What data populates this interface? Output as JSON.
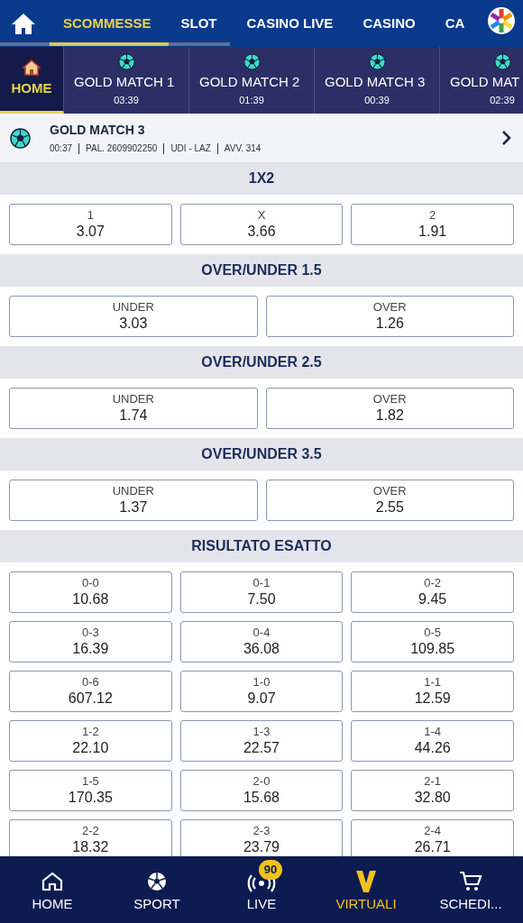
{
  "top_nav": {
    "items": [
      {
        "label": "SCOMMESSE",
        "selected": true
      },
      {
        "label": "SLOT",
        "selected": false
      },
      {
        "label": "CASINO LIVE",
        "selected": false
      },
      {
        "label": "CASINO",
        "selected": false
      },
      {
        "label": "CA",
        "selected": false
      }
    ]
  },
  "match_tabs": [
    {
      "kind": "home",
      "label": "HOME",
      "selected": true
    },
    {
      "kind": "match",
      "label": "GOLD MATCH 1",
      "time": "03:39",
      "selected": false
    },
    {
      "kind": "match",
      "label": "GOLD MATCH 2",
      "time": "01:39",
      "selected": false
    },
    {
      "kind": "match",
      "label": "GOLD MATCH 3",
      "time": "00:39",
      "selected": false
    },
    {
      "kind": "match",
      "label": "GOLD MAT",
      "time": "02:39",
      "selected": false
    }
  ],
  "event": {
    "title": "GOLD MATCH 3",
    "info": [
      "00:37",
      "PAL. 2609902250",
      "UDI - LAZ",
      "AVV. 314"
    ]
  },
  "markets": [
    {
      "title": "1X2",
      "outcomes": [
        {
          "label": "1",
          "odd": "3.07"
        },
        {
          "label": "X",
          "odd": "3.66"
        },
        {
          "label": "2",
          "odd": "1.91"
        }
      ]
    },
    {
      "title": "OVER/UNDER 1.5",
      "outcomes": [
        {
          "label": "UNDER",
          "odd": "3.03"
        },
        {
          "label": "OVER",
          "odd": "1.26"
        }
      ]
    },
    {
      "title": "OVER/UNDER 2.5",
      "outcomes": [
        {
          "label": "UNDER",
          "odd": "1.74"
        },
        {
          "label": "OVER",
          "odd": "1.82"
        }
      ]
    },
    {
      "title": "OVER/UNDER 3.5",
      "outcomes": [
        {
          "label": "UNDER",
          "odd": "1.37"
        },
        {
          "label": "OVER",
          "odd": "2.55"
        }
      ]
    },
    {
      "title": "RISULTATO ESATTO",
      "outcomes": [
        {
          "label": "0-0",
          "odd": "10.68"
        },
        {
          "label": "0-1",
          "odd": "7.50"
        },
        {
          "label": "0-2",
          "odd": "9.45"
        },
        {
          "label": "0-3",
          "odd": "16.39"
        },
        {
          "label": "0-4",
          "odd": "36.08"
        },
        {
          "label": "0-5",
          "odd": "109.85"
        },
        {
          "label": "0-6",
          "odd": "607.12"
        },
        {
          "label": "1-0",
          "odd": "9.07"
        },
        {
          "label": "1-1",
          "odd": "12.59"
        },
        {
          "label": "1-2",
          "odd": "22.10"
        },
        {
          "label": "1-3",
          "odd": "22.57"
        },
        {
          "label": "1-4",
          "odd": "44.26"
        },
        {
          "label": "1-5",
          "odd": "170.35"
        },
        {
          "label": "2-0",
          "odd": "15.68"
        },
        {
          "label": "2-1",
          "odd": "32.80"
        },
        {
          "label": "2-2",
          "odd": "18.32"
        },
        {
          "label": "2-3",
          "odd": "23.79"
        },
        {
          "label": "2-4",
          "odd": "26.71"
        }
      ]
    }
  ],
  "bottom_nav": [
    {
      "kind": "home",
      "label": "HOME",
      "selected": false
    },
    {
      "kind": "sport",
      "label": "SPORT",
      "selected": false
    },
    {
      "kind": "live",
      "label": "LIVE",
      "badge": "90",
      "selected": false
    },
    {
      "kind": "virtual",
      "label": "VIRTUALI",
      "selected": true
    },
    {
      "kind": "cart",
      "label": "SCHEDI...",
      "selected": false
    }
  ]
}
